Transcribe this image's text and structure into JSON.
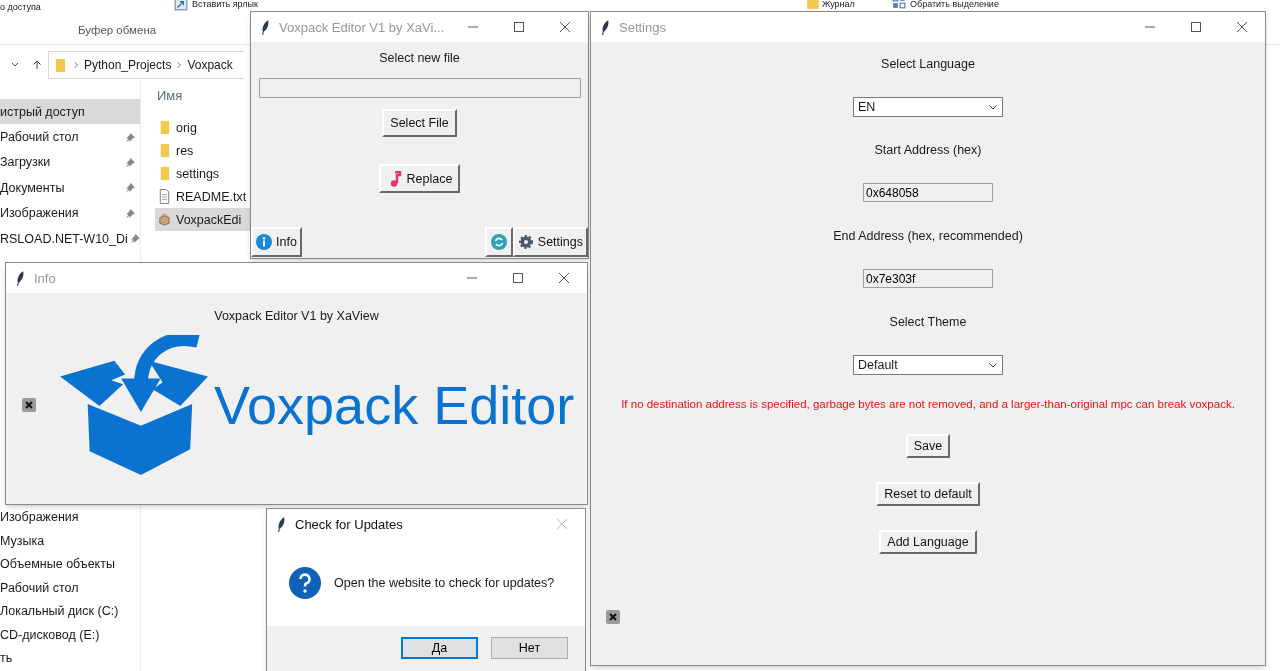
{
  "explorer": {
    "ribbon": {
      "quick_access": "о доступа",
      "clipboard_group": "Буфер обмена",
      "paste_shortcut": "Вставить ярлык",
      "history": "Журнал",
      "invert_selection": "Обратить выделение"
    },
    "path": [
      "Python_Projects",
      "Voxpack"
    ],
    "nav_top": [
      {
        "label": "истрый доступ",
        "selected": true,
        "pinned": false
      },
      {
        "label": "Рабочий стол",
        "selected": false,
        "pinned": true
      },
      {
        "label": "Загрузки",
        "selected": false,
        "pinned": true
      },
      {
        "label": "Документы",
        "selected": false,
        "pinned": true
      },
      {
        "label": "Изображения",
        "selected": false,
        "pinned": true
      },
      {
        "label": "RSLOAD.NET-W10_Di",
        "selected": false,
        "pinned": true
      }
    ],
    "nav_bottom": [
      {
        "label": "Изображения",
        "selected": false,
        "pinned": false
      },
      {
        "label": "Музыка",
        "selected": false,
        "pinned": false
      },
      {
        "label": "Объемные объекты",
        "selected": false,
        "pinned": false
      },
      {
        "label": "Рабочий стол",
        "selected": false,
        "pinned": false
      },
      {
        "label": "Локальный диск (C:)",
        "selected": false,
        "pinned": false
      },
      {
        "label": "CD-дисковод (E:)",
        "selected": false,
        "pinned": false
      },
      {
        "label": "ть",
        "selected": false,
        "pinned": false
      }
    ],
    "column_header": "Имя",
    "files": [
      {
        "name": "orig",
        "kind": "folder",
        "selected": false
      },
      {
        "name": "res",
        "kind": "folder",
        "selected": false
      },
      {
        "name": "settings",
        "kind": "folder",
        "selected": false
      },
      {
        "name": "README.txt",
        "kind": "text",
        "selected": false
      },
      {
        "name": "VoxpackEdi",
        "kind": "app",
        "selected": true
      }
    ]
  },
  "editor": {
    "title": "Voxpack Editor V1 by XaVi...",
    "active": false,
    "prompt": "Select new file",
    "select_button": "Select File",
    "replace_button": "Replace",
    "info_button": "Info",
    "settings_button": "Settings"
  },
  "settings": {
    "title": "Settings",
    "active": false,
    "items": [
      {
        "kind": "label",
        "text": "Select Language"
      },
      {
        "kind": "dropdown",
        "text": "EN"
      },
      {
        "kind": "label",
        "text": "Start Address (hex)"
      },
      {
        "kind": "entry",
        "text": "0x648058"
      },
      {
        "kind": "label",
        "text": "End Address (hex, recommended)"
      },
      {
        "kind": "entry",
        "text": "0x7e303f"
      },
      {
        "kind": "label",
        "text": "Select Theme"
      },
      {
        "kind": "dropdown",
        "text": "Default"
      },
      {
        "kind": "warning",
        "text": "If no destination address is specified, garbage bytes are not removed, and a larger-than-original mpc can break voxpack."
      },
      {
        "kind": "button",
        "text": "Save"
      },
      {
        "kind": "button",
        "text": "Reset to default"
      },
      {
        "kind": "button",
        "text": "Add Language"
      }
    ]
  },
  "info": {
    "title": "Info",
    "active": false,
    "caption": "Voxpack Editor V1 by XaView",
    "logo_text": "Voxpack Editor"
  },
  "dialog": {
    "title": "Check for Updates",
    "active": true,
    "message": "Open the website to check for updates?",
    "buttons": [
      {
        "label": "Да",
        "default": true
      },
      {
        "label": "Нет",
        "default": false
      }
    ]
  }
}
